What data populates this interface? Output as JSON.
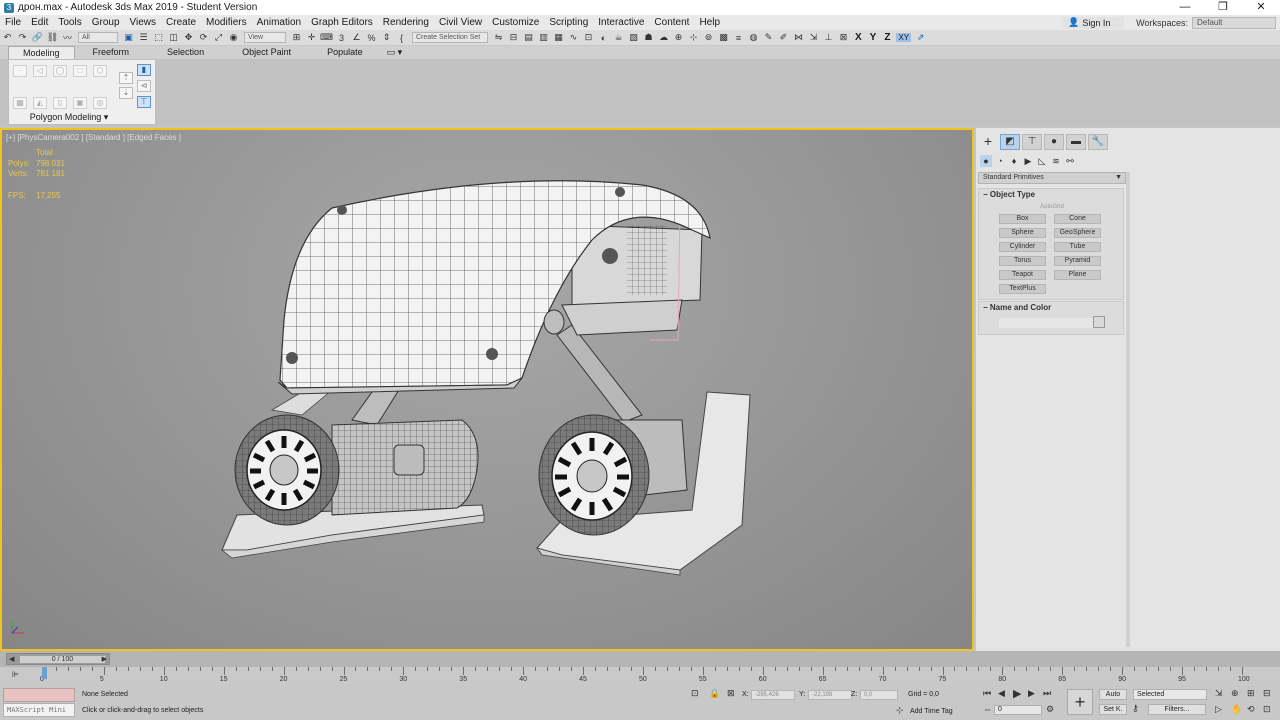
{
  "window": {
    "title": "дрон.max - Autodesk 3ds Max 2019 - Student Version",
    "controls": [
      "—",
      "❐",
      "✕"
    ]
  },
  "menu": {
    "items": [
      "File",
      "Edit",
      "Tools",
      "Group",
      "Views",
      "Create",
      "Modifiers",
      "Animation",
      "Graph Editors",
      "Rendering",
      "Civil View",
      "Customize",
      "Scripting",
      "Interactive",
      "Content",
      "Help"
    ],
    "sign_in": "Sign In",
    "workspaces_label": "Workspaces:",
    "workspace_value": "Default"
  },
  "toolbar": {
    "filter_value": "All",
    "ref_coord_value": "View",
    "selection_set_placeholder": "Create Selection Set",
    "axis_x": "X",
    "axis_y": "Y",
    "axis_z": "Z",
    "axis_xy": "XY"
  },
  "ribbon": {
    "tabs": [
      "Modeling",
      "Freeform",
      "Selection",
      "Object Paint",
      "Populate"
    ],
    "active_tab": "Modeling",
    "panel_title": "Polygon Modeling ▾"
  },
  "viewport": {
    "label": "[+] [PhysCamera002 ] [Standard ] [Edged Faces ]",
    "stats": {
      "header": "Total",
      "polys_label": "Polys:",
      "polys_value": "798 031",
      "verts_label": "Verts:",
      "verts_value": "781 181",
      "fps_label": "FPS:",
      "fps_value": "17,255"
    },
    "border_color": "#f0c419"
  },
  "command_panel": {
    "category": "Standard Primitives",
    "object_type_title": "Object Type",
    "autogrid": "AutoGrid",
    "primitives": [
      "Box",
      "Cone",
      "Sphere",
      "GeoSphere",
      "Cylinder",
      "Tube",
      "Torus",
      "Pyramid",
      "Teapot",
      "Plane",
      "TextPlus"
    ],
    "name_color_title": "Name and Color"
  },
  "timeline": {
    "slider_text": "0 / 100",
    "ticks": [
      "0",
      "5",
      "10",
      "15",
      "20",
      "25",
      "30",
      "35",
      "40",
      "45",
      "50",
      "55",
      "60",
      "65",
      "70",
      "75",
      "80",
      "85",
      "90",
      "95",
      "100"
    ]
  },
  "status": {
    "maxscript_label": "MAXScript Mini",
    "selected": "None Selected",
    "prompt": "Click or click-and-drag to select objects",
    "x_label": "X:",
    "x_value": "-295,426",
    "y_label": "Y:",
    "y_value": "-22,198",
    "z_label": "Z:",
    "z_value": "0,0",
    "grid": "Grid = 0,0",
    "add_time_tag": "Add Time Tag",
    "auto": "Auto",
    "selected_drop": "Selected",
    "set_key": "Set K.",
    "filters": "Filters...",
    "current_frame": "0"
  }
}
